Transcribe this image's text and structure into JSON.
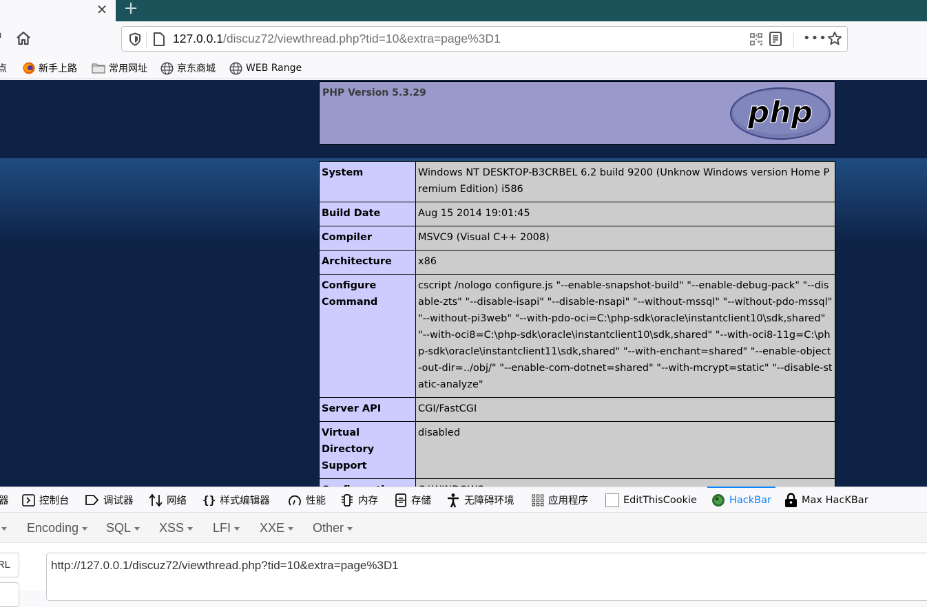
{
  "browser": {
    "tab": {
      "close_icon": "×",
      "new_tab_icon": "+"
    },
    "urlbar": {
      "host": "127.0.0.1",
      "path": "/discuz72/viewthread.php?tid=10&extra=page%3D1",
      "more_icon": "•••"
    },
    "bookmarks": [
      {
        "label": "点",
        "icon": "bookmark-icon"
      },
      {
        "label": "新手上路",
        "icon": "firefox-icon"
      },
      {
        "label": "常用网址",
        "icon": "folder-icon"
      },
      {
        "label": "京东商城",
        "icon": "globe-icon"
      },
      {
        "label": "WEB Range",
        "icon": "globe-icon"
      }
    ]
  },
  "phpinfo": {
    "version_title": "PHP Version 5.3.29",
    "rows": [
      {
        "key": "System",
        "value": "Windows NT DESKTOP-B3CRBEL 6.2 build 9200 (Unknow Windows version Home Premium Edition) i586"
      },
      {
        "key": "Build Date",
        "value": "Aug 15 2014 19:01:45"
      },
      {
        "key": "Compiler",
        "value": "MSVC9 (Visual C++ 2008)"
      },
      {
        "key": "Architecture",
        "value": "x86"
      },
      {
        "key": "Configure Command",
        "value": "cscript /nologo configure.js \"--enable-snapshot-build\" \"--enable-debug-pack\" \"--disable-zts\" \"--disable-isapi\" \"--disable-nsapi\" \"--without-mssql\" \"--without-pdo-mssql\" \"--without-pi3web\" \"--with-pdo-oci=C:\\php-sdk\\oracle\\instantclient10\\sdk,shared\" \"--with-oci8=C:\\php-sdk\\oracle\\instantclient10\\sdk,shared\" \"--with-oci8-11g=C:\\php-sdk\\oracle\\instantclient11\\sdk,shared\" \"--with-enchant=shared\" \"--enable-object-out-dir=../obj/\" \"--enable-com-dotnet=shared\" \"--with-mcrypt=static\" \"--disable-static-analyze\""
      },
      {
        "key": "Server API",
        "value": "CGI/FastCGI"
      },
      {
        "key": "Virtual Directory Support",
        "value": "disabled"
      },
      {
        "key": "Configuration",
        "value": "C:\\WINDOWS"
      }
    ]
  },
  "devtools": {
    "tabs": [
      {
        "label": "器"
      },
      {
        "label": "控制台"
      },
      {
        "label": "调试器"
      },
      {
        "label": "网络"
      },
      {
        "label": "样式编辑器"
      },
      {
        "label": "性能"
      },
      {
        "label": "内存"
      },
      {
        "label": "存储"
      },
      {
        "label": "无障碍环境"
      },
      {
        "label": "应用程序"
      },
      {
        "label": "EditThisCookie"
      },
      {
        "label": "HackBar",
        "active": true
      },
      {
        "label": "Max HacKBar"
      }
    ],
    "accent_color": "#0a84ff"
  },
  "hackbar": {
    "menus": [
      "Encoding",
      "SQL",
      "XSS",
      "LFI",
      "XXE",
      "Other"
    ],
    "load_url_label": "RL",
    "url_value": "http://127.0.0.1/discuz72/viewthread.php?tid=10&extra=page%3D1"
  }
}
